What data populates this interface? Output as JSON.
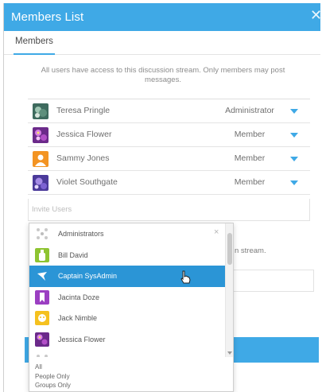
{
  "dialog": {
    "title": "Members List",
    "close_glyph": "✕"
  },
  "tabs": [
    {
      "label": "Members",
      "active": true
    }
  ],
  "info_text": "All users have access to this discussion stream. Only members may post messages.",
  "members": [
    {
      "name": "Teresa Pringle",
      "role": "Administrator",
      "avatar": "teal-flower-photo"
    },
    {
      "name": "Jessica Flower",
      "role": "Member",
      "avatar": "purple-flower-photo"
    },
    {
      "name": "Sammy Jones",
      "role": "Member",
      "avatar": "orange-person-icon"
    },
    {
      "name": "Violet Southgate",
      "role": "Member",
      "avatar": "violet-flower-photo"
    }
  ],
  "invite": {
    "placeholder": "Invite Users"
  },
  "background": {
    "partial_text": "n stream."
  },
  "dropdown": {
    "clear_glyph": "×",
    "items": [
      {
        "label": "Administrators",
        "avatar": "group-dots-icon"
      },
      {
        "label": "Bill David",
        "avatar": "green-bottle-icon"
      },
      {
        "label": "Captain SysAdmin",
        "avatar": "blue-bird-icon",
        "selected": true
      },
      {
        "label": "Jacinta Doze",
        "avatar": "purple-bookmark-icon"
      },
      {
        "label": "Jack Nimble",
        "avatar": "yellow-face-icon"
      },
      {
        "label": "Jessica Flower",
        "avatar": "purple-flower-photo"
      },
      {
        "label": "",
        "avatar": "group-dots-icon",
        "partial": true
      }
    ],
    "filters": [
      "All",
      "People Only",
      "Groups Only"
    ]
  },
  "colors": {
    "accent": "#3fa9e6",
    "selected": "#2b95d6"
  }
}
